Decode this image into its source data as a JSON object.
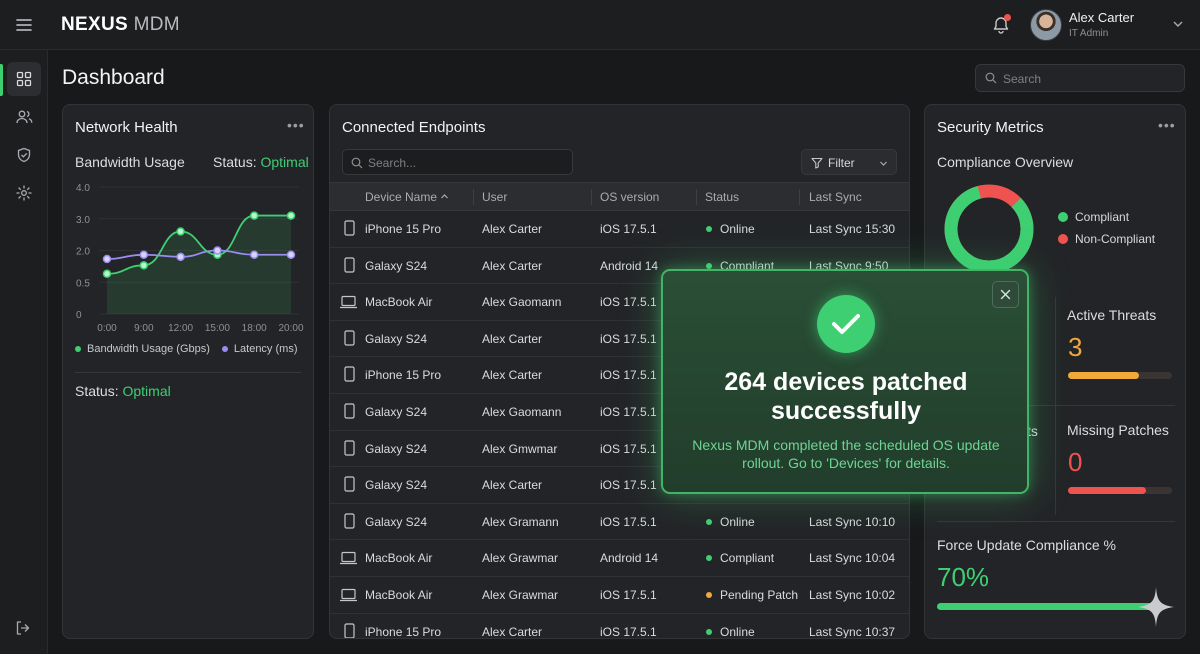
{
  "app": {
    "brand_bold": "NEXUS",
    "brand_light": "MDM"
  },
  "user": {
    "name": "Alex Carter",
    "role": "IT Admin"
  },
  "page": {
    "title": "Dashboard",
    "search_placeholder": "Search"
  },
  "network_health": {
    "title": "Network Health",
    "subtitle": "Bandwidth Usage",
    "status_label": "Status:",
    "status_value": "Optimal",
    "footer_status_label": "Status:",
    "footer_status_value": "Optimal",
    "chart_data": {
      "type": "line",
      "x": [
        "0:00",
        "9:00",
        "12:00",
        "15:00",
        "18:00",
        "20:00"
      ],
      "y_ticks": [
        "4.0",
        "3.0",
        "2.0",
        "0.5",
        "0"
      ],
      "series": [
        {
          "name": "Bandwidth Usage (Gbps)",
          "color": "#3ecf73",
          "values": [
            0.9,
            1.3,
            2.6,
            1.8,
            3.1,
            3.1
          ]
        },
        {
          "name": "Latency (ms)",
          "color": "#9b8cf0",
          "values": [
            1.6,
            1.8,
            1.7,
            2.0,
            1.8,
            1.8
          ]
        }
      ]
    }
  },
  "endpoints": {
    "title": "Connected Endpoints",
    "search_placeholder": "Search...",
    "filter_label": "Filter",
    "columns": [
      "Device Name",
      "User",
      "OS version",
      "Status",
      "Last Sync"
    ],
    "rows": [
      {
        "type": "phone",
        "device": "iPhone 15 Pro",
        "user": "Alex Carter",
        "os": "iOS 17.5.1",
        "status": "Online",
        "sync": "Last Sync 15:30"
      },
      {
        "type": "phone",
        "device": "Galaxy S24",
        "user": "Alex Carter",
        "os": "Android 14",
        "status": "Compliant",
        "sync": "Last Sync 9:50"
      },
      {
        "type": "laptop",
        "device": "MacBook Air",
        "user": "Alex Gaomann",
        "os": "iOS 17.5.1",
        "status": "",
        "sync": ""
      },
      {
        "type": "phone",
        "device": "Galaxy S24",
        "user": "Alex Carter",
        "os": "iOS 17.5.1",
        "status": "",
        "sync": ""
      },
      {
        "type": "phone",
        "device": "iPhone 15 Pro",
        "user": "Alex Carter",
        "os": "iOS 17.5.1",
        "status": "",
        "sync": ""
      },
      {
        "type": "phone",
        "device": "Galaxy S24",
        "user": "Alex Gaomann",
        "os": "iOS 17.5.1",
        "status": "",
        "sync": ""
      },
      {
        "type": "phone",
        "device": "Galaxy S24",
        "user": "Alex Gmwmar",
        "os": "iOS 17.5.1",
        "status": "",
        "sync": ""
      },
      {
        "type": "phone",
        "device": "Galaxy S24",
        "user": "Alex Carter",
        "os": "iOS 17.5.1",
        "status": "",
        "sync": ""
      },
      {
        "type": "phone",
        "device": "Galaxy S24",
        "user": "Alex Gramann",
        "os": "iOS 17.5.1",
        "status": "Online",
        "sync": "Last Sync 10:10"
      },
      {
        "type": "laptop",
        "device": "MacBook Air",
        "user": "Alex Grawmar",
        "os": "Android 14",
        "status": "Compliant",
        "sync": "Last Sync 10:04"
      },
      {
        "type": "laptop",
        "device": "MacBook Air",
        "user": "Alex Grawmar",
        "os": "iOS 17.5.1",
        "status": "Pending Patch",
        "sync": "Last Sync 10:02"
      },
      {
        "type": "phone",
        "device": "iPhone 15 Pro",
        "user": "Alex Carter",
        "os": "iOS 17.5.1",
        "status": "Online",
        "sync": "Last Sync 10:37"
      }
    ],
    "status_colors": {
      "Online": "#3ecf73",
      "Compliant": "#3ecf73",
      "Pending Patch": "#f0a93a"
    }
  },
  "security": {
    "title": "Security Metrics",
    "compliance_title": "Compliance Overview",
    "legend": [
      {
        "label": "Compliant",
        "color": "#3ecf73"
      },
      {
        "label": "Non-Compliant",
        "color": "#ef5350"
      }
    ],
    "compliance_fraction": 0.83,
    "left_metric_fragment": "ts",
    "active_threats": {
      "label": "Active Threats",
      "value": "3",
      "color": "#f0a93a",
      "fraction": 0.68
    },
    "missing_patches": {
      "label": "Missing Patches",
      "value": "0",
      "color": "#ef5350",
      "fraction": 0.75
    },
    "force_update": {
      "label": "Force Update Compliance %",
      "value": "70%",
      "color": "#3ecf73",
      "fraction": 0.97
    }
  },
  "toast": {
    "title": "264 devices patched successfully",
    "message": "Nexus MDM completed the scheduled OS update rollout. Go to 'Devices' for details."
  }
}
